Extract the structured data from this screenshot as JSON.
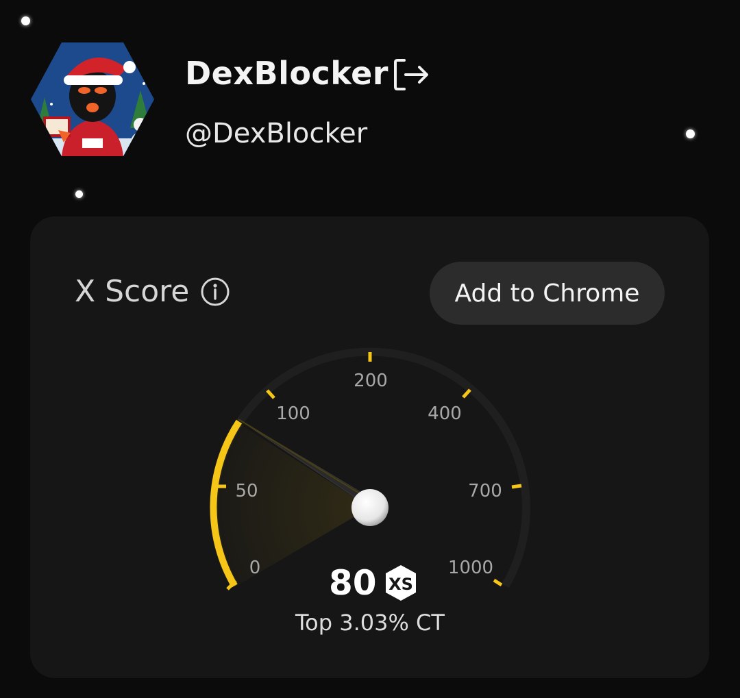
{
  "profile": {
    "name": "DexBlocker",
    "handle": "@DexBlocker",
    "avatar_icon": "santa-hat-masked-character-avatar",
    "logout_icon": "logout-icon"
  },
  "score_card": {
    "title": "X Score",
    "info_icon": "info-icon",
    "add_button_label": "Add to Chrome",
    "gauge": {
      "tick_labels": [
        "0",
        "50",
        "100",
        "200",
        "400",
        "700",
        "1000"
      ],
      "value": 80,
      "accent_color": "#f5c518",
      "track_color": "#222222"
    },
    "score_value": "80",
    "score_badge_icon": "xs-logo-icon",
    "rank_text": "Top 3.03% CT"
  },
  "colors": {
    "background": "#0b0b0b",
    "card": "#161616",
    "button": "#2c2c2c",
    "accent": "#f5c518"
  }
}
